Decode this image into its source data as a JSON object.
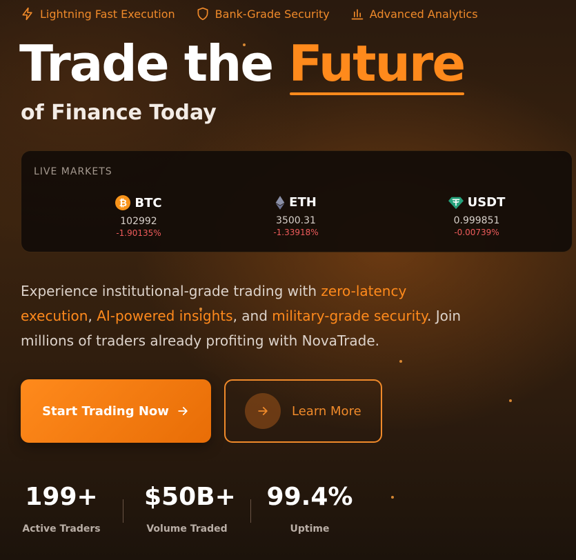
{
  "features": [
    {
      "label": "Lightning Fast Execution",
      "icon": "lightning-icon"
    },
    {
      "label": "Bank-Grade Security",
      "icon": "shield-icon"
    },
    {
      "label": "Advanced Analytics",
      "icon": "bar-chart-icon"
    }
  ],
  "hero": {
    "title_prefix": "Trade the ",
    "title_accent": "Future",
    "subtitle": "of Finance Today"
  },
  "markets": {
    "label": "LIVE MARKETS",
    "coins": [
      {
        "symbol": "BTC",
        "price": "102992",
        "change": "-1.90135%",
        "icon": "bitcoin-icon"
      },
      {
        "symbol": "ETH",
        "price": "3500.31",
        "change": "-1.33918%",
        "icon": "ethereum-icon"
      },
      {
        "symbol": "USDT",
        "price": "0.999851",
        "change": "-0.00739%",
        "icon": "tether-icon"
      }
    ]
  },
  "description": {
    "part1": "Experience institutional-grade trading with ",
    "hl1": "zero-latency execution",
    "part2": ", ",
    "hl2": "AI-powered insights",
    "part3": ", and ",
    "hl3": "military-grade security",
    "part4": ". Join millions of traders already profiting with NovaTrade."
  },
  "cta": {
    "primary_label": "Start Trading Now",
    "secondary_label": "Learn More"
  },
  "stats": [
    {
      "value": "199+",
      "label": "Active Traders"
    },
    {
      "value": "$50B+",
      "label": "Volume Traded"
    },
    {
      "value": "99.4%",
      "label": "Uptime"
    }
  ],
  "colors": {
    "accent": "#ff8a1c",
    "negative": "#ef5b5b",
    "background": "#2a1a0e"
  }
}
